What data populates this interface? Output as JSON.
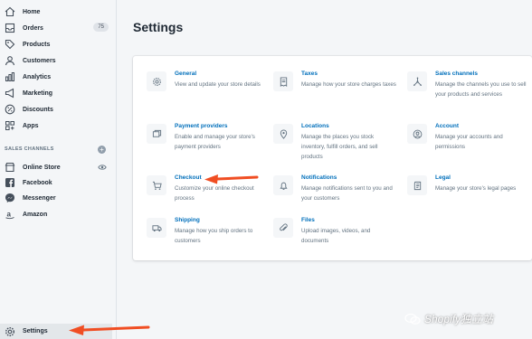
{
  "sidebar": {
    "items": [
      {
        "label": "Home",
        "icon": "home-icon"
      },
      {
        "label": "Orders",
        "icon": "orders-icon",
        "badge": "75"
      },
      {
        "label": "Products",
        "icon": "tag-icon"
      },
      {
        "label": "Customers",
        "icon": "customers-icon"
      },
      {
        "label": "Analytics",
        "icon": "analytics-icon"
      },
      {
        "label": "Marketing",
        "icon": "megaphone-icon"
      },
      {
        "label": "Discounts",
        "icon": "discount-icon"
      },
      {
        "label": "Apps",
        "icon": "apps-icon"
      }
    ],
    "section_label": "SALES CHANNELS",
    "channels": [
      {
        "label": "Online Store",
        "icon": "store-icon"
      },
      {
        "label": "Facebook",
        "icon": "facebook-icon"
      },
      {
        "label": "Messenger",
        "icon": "messenger-icon"
      },
      {
        "label": "Amazon",
        "icon": "amazon-icon"
      }
    ],
    "settings_label": "Settings"
  },
  "main": {
    "title": "Settings",
    "tiles": [
      {
        "title": "General",
        "desc": "View and update your store details",
        "icon": "gear-icon"
      },
      {
        "title": "Taxes",
        "desc": "Manage how your store charges taxes",
        "icon": "receipt-icon"
      },
      {
        "title": "Sales channels",
        "desc": "Manage the channels you use to sell your products and services",
        "icon": "channels-icon"
      },
      {
        "title": "Payment providers",
        "desc": "Enable and manage your store's payment providers",
        "icon": "payment-icon"
      },
      {
        "title": "Locations",
        "desc": "Manage the places you stock inventory, fulfill orders, and sell products",
        "icon": "location-icon"
      },
      {
        "title": "Account",
        "desc": "Manage your accounts and permissions",
        "icon": "account-icon"
      },
      {
        "title": "Checkout",
        "desc": "Customize your online checkout process",
        "icon": "cart-icon"
      },
      {
        "title": "Notifications",
        "desc": "Manage notifications sent to you and your customers",
        "icon": "bell-icon"
      },
      {
        "title": "Legal",
        "desc": "Manage your store's legal pages",
        "icon": "legal-icon"
      },
      {
        "title": "Shipping",
        "desc": "Manage how you ship orders to customers",
        "icon": "truck-icon"
      },
      {
        "title": "Files",
        "desc": "Upload images, videos, and documents",
        "icon": "paperclip-icon"
      }
    ]
  },
  "watermark": "Shopify独立站",
  "colors": {
    "link": "#006fbb",
    "arrow": "#f04e23",
    "sidebar_bg": "#f4f6f8"
  }
}
